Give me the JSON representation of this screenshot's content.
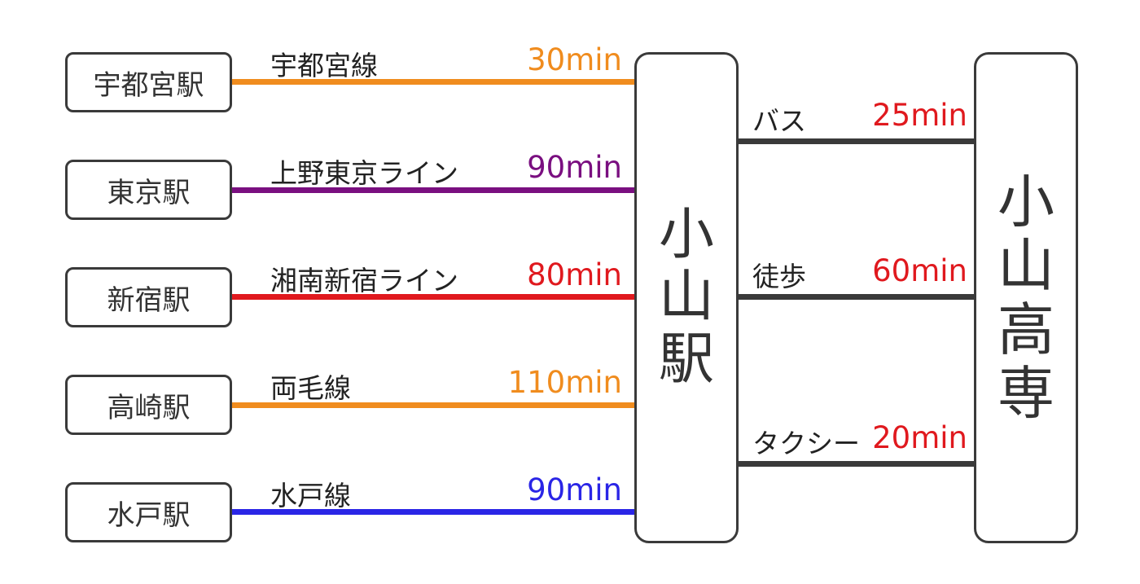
{
  "colors": {
    "orange": "#f08c1e",
    "purple": "#7a0f80",
    "red": "#e0191e",
    "blue": "#2a25e6",
    "dark": "#3a3a3a"
  },
  "hub_station": {
    "chars": [
      "小",
      "山",
      "駅"
    ]
  },
  "destination": {
    "chars": [
      "小",
      "山",
      "高",
      "専"
    ]
  },
  "routes": [
    {
      "station": "宇都宮駅",
      "line": "宇都宮線",
      "time": "30min",
      "color": "#f08c1e"
    },
    {
      "station": "東京駅",
      "line": "上野東京ライン",
      "time": "90min",
      "color": "#7a0f80"
    },
    {
      "station": "新宿駅",
      "line": "湘南新宿ライン",
      "time": "80min",
      "color": "#e0191e"
    },
    {
      "station": "高崎駅",
      "line": "両毛線",
      "time": "110min",
      "color": "#f08c1e"
    },
    {
      "station": "水戸駅",
      "line": "水戸線",
      "time": "90min",
      "color": "#2a25e6"
    }
  ],
  "access": [
    {
      "mode": "バス",
      "time": "25min",
      "color": "#e0191e"
    },
    {
      "mode": "徒歩",
      "time": "60min",
      "color": "#e0191e"
    },
    {
      "mode": "タクシー",
      "time": "20min",
      "color": "#e0191e"
    }
  ]
}
